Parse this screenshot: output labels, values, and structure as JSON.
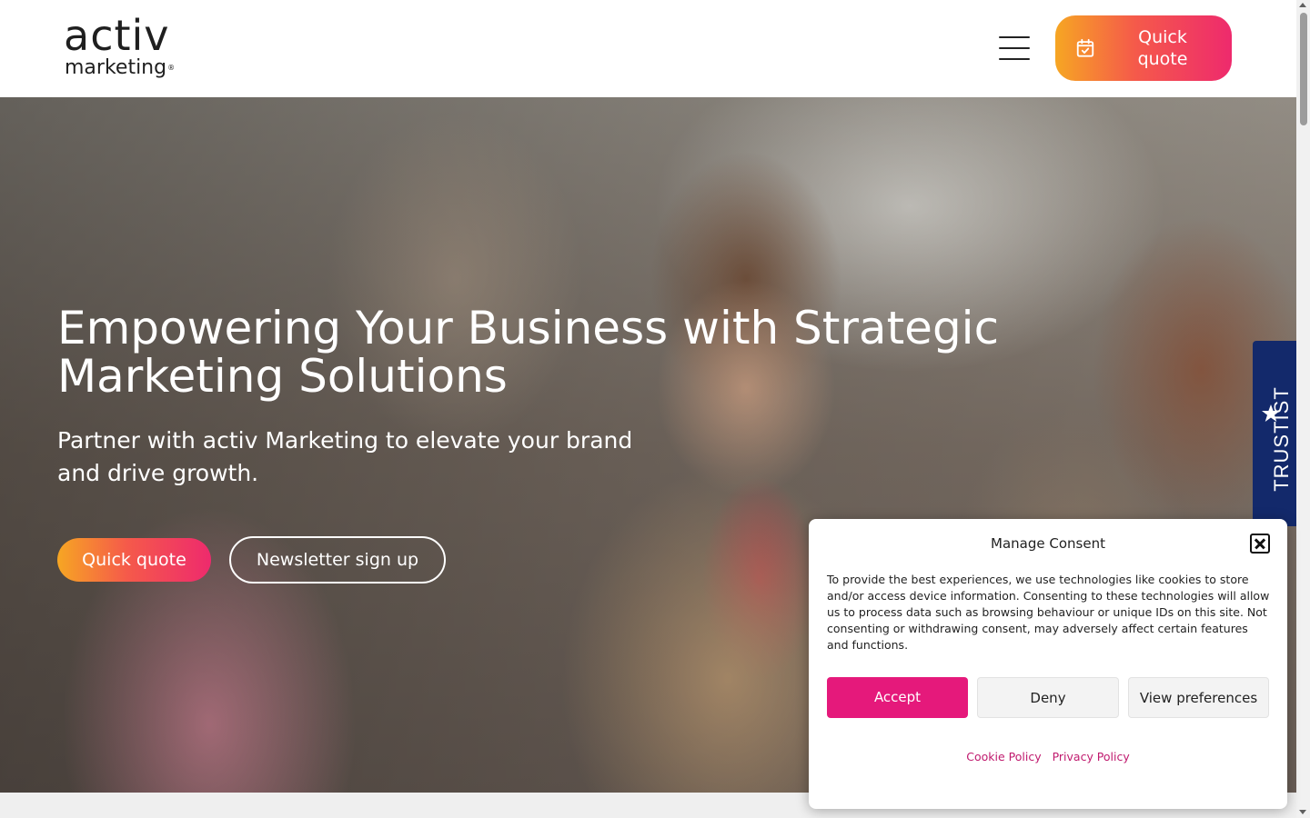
{
  "header": {
    "logo_main": "activ",
    "logo_sub": "marketing",
    "logo_reg": "®",
    "quote_label": "Quick quote"
  },
  "hero": {
    "title": "Empowering Your Business with Strategic Marketing Solutions",
    "subtitle": "Partner with activ Marketing to elevate your brand and drive growth.",
    "quote_button": "Quick quote",
    "newsletter_button": "Newsletter sign up"
  },
  "trustist": {
    "label": "TRUSTIST"
  },
  "consent": {
    "title": "Manage Consent",
    "body": "To provide the best experiences, we use technologies like cookies to store and/or access device information. Consenting to these technologies will allow us to process data such as browsing behaviour or unique IDs on this site. Not consenting or withdrawing consent, may adversely affect certain features and functions.",
    "accept": "Accept",
    "deny": "Deny",
    "preferences": "View preferences",
    "cookie_policy": "Cookie Policy",
    "privacy_policy": "Privacy Policy"
  },
  "colors": {
    "brand_gradient_start": "#f6a623",
    "brand_gradient_end": "#ee2a6d",
    "accept_pink": "#e5197b",
    "trustist_navy": "#13296b"
  },
  "icons": [
    "calendar-check-icon",
    "hamburger-menu-icon",
    "star-icon",
    "close-icon"
  ]
}
